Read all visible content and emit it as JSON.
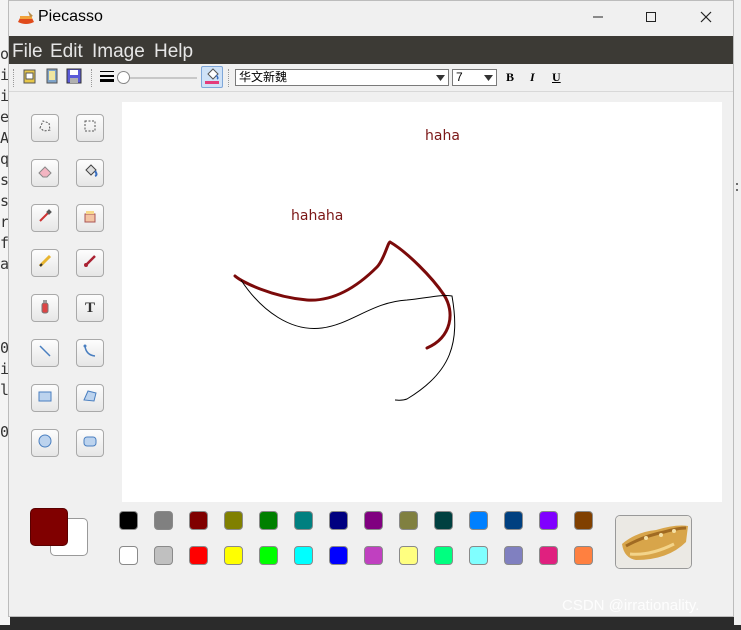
{
  "app": {
    "title": "Piecasso",
    "icon": "paintbrush-icon"
  },
  "window_controls": {
    "minimize": "minimize-icon",
    "maximize": "maximize-icon",
    "close": "close-icon"
  },
  "menu": {
    "items": [
      "File",
      "Edit",
      "Image",
      "Help"
    ]
  },
  "background_text": [
    "o",
    "i",
    "i",
    "e",
    "A",
    "q",
    "s",
    "s",
    "r",
    "f",
    "a",
    "",
    "",
    "",
    "0",
    "i",
    "l",
    "",
    "0"
  ],
  "toolbar": {
    "buttons": [
      "new-file-icon",
      "open-file-icon",
      "save-file-icon"
    ],
    "line_width_icon": "line-width-icon",
    "slider_value": 0,
    "fill_icon": "fill-bucket-icon",
    "font_name": "华文新魏",
    "font_size": "7",
    "bold": "B",
    "italic": "I",
    "underline": "U"
  },
  "tools": [
    "free-select-icon",
    "rect-select-icon",
    "eraser-icon",
    "fill-icon",
    "color-picker-icon",
    "stamp-icon",
    "pencil-icon",
    "brush-icon",
    "airbrush-icon",
    "text-icon",
    "line-icon",
    "curve-icon",
    "rectangle-icon",
    "polygon-icon",
    "ellipse-icon",
    "rounded-rect-icon"
  ],
  "canvas": {
    "texts": [
      "haha",
      "hahaha"
    ]
  },
  "colors": {
    "primary": "#800000",
    "secondary": "#ffffff",
    "palette_row1": [
      "#000000",
      "#808080",
      "#800000",
      "#808000",
      "#008000",
      "#008080",
      "#000080",
      "#800080",
      "#808040",
      "#004040",
      "#0080ff",
      "#004080",
      "#8000ff",
      "#804000"
    ],
    "palette_row2": [
      "#ffffff",
      "#c0c0c0",
      "#ff0000",
      "#ffff00",
      "#00ff00",
      "#00ffff",
      "#0000ff",
      "#c040c0",
      "#ffff80",
      "#00ff80",
      "#80ffff",
      "#8080c0",
      "#e0207f",
      "#ff8040"
    ]
  },
  "watermark": "CSDN @irrationality."
}
